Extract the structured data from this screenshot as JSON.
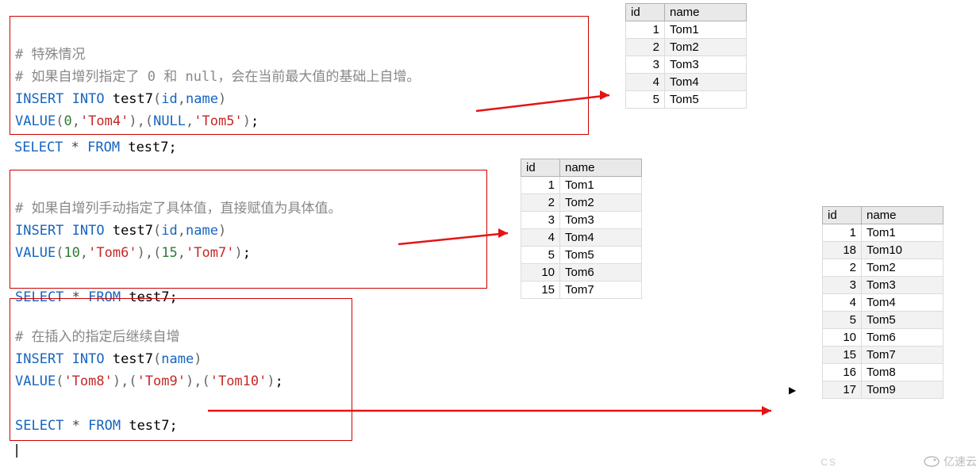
{
  "block1": {
    "c1": "# 特殊情况",
    "c2_a": "# 如果自增列指定了 ",
    "c2_b": "0",
    "c2_c": " 和 ",
    "c2_d": "null",
    "c2_e": "，会在当前最大值的基础上自增。",
    "kw1": "INSERT INTO",
    "call": " test7",
    "args": "id",
    "args2": "name",
    "kw2": "VALUE",
    "v0": "0",
    "s1": "'Tom4'",
    "vnull": "NULL",
    "s2": "'Tom5'",
    "sel_kw1": "SELECT",
    "sel_star": " * ",
    "sel_kw2": "FROM",
    "sel_id": " test7",
    "semi": ";"
  },
  "block2": {
    "c1": "# 如果自增列手动指定了具体值，直接赋值为具体值。",
    "kw1": "INSERT INTO",
    "call": " test7",
    "args": "id",
    "args2": "name",
    "kw2": "VALUE",
    "v10": "10",
    "s1": "'Tom6'",
    "v15": "15",
    "s2": "'Tom7'",
    "sel_kw1": "SELECT",
    "sel_star": " * ",
    "sel_kw2": "FROM",
    "sel_id": " test7",
    "semi": ";"
  },
  "block3": {
    "c1": "# 在插入的指定后继续自增",
    "kw1": "INSERT INTO",
    "call": " test7",
    "args": "name",
    "kw2": "VALUE",
    "s1": "'Tom8'",
    "s2": "'Tom9'",
    "s3": "'Tom10'",
    "sel_kw1": "SELECT",
    "sel_star": " * ",
    "sel_kw2": "FROM",
    "sel_id": " test7",
    "semi": ";"
  },
  "table1": {
    "h1": "id",
    "h2": "name",
    "rows": [
      {
        "id": "1",
        "name": "Tom1"
      },
      {
        "id": "2",
        "name": "Tom2"
      },
      {
        "id": "3",
        "name": "Tom3"
      },
      {
        "id": "4",
        "name": "Tom4"
      },
      {
        "id": "5",
        "name": "Tom5"
      }
    ]
  },
  "table2": {
    "h1": "id",
    "h2": "name",
    "rows": [
      {
        "id": "1",
        "name": "Tom1"
      },
      {
        "id": "2",
        "name": "Tom2"
      },
      {
        "id": "3",
        "name": "Tom3"
      },
      {
        "id": "4",
        "name": "Tom4"
      },
      {
        "id": "5",
        "name": "Tom5"
      },
      {
        "id": "10",
        "name": "Tom6"
      },
      {
        "id": "15",
        "name": "Tom7"
      }
    ]
  },
  "table3": {
    "h1": "id",
    "h2": "name",
    "rows": [
      {
        "id": "1",
        "name": "Tom1"
      },
      {
        "id": "18",
        "name": "Tom10"
      },
      {
        "id": "2",
        "name": "Tom2"
      },
      {
        "id": "3",
        "name": "Tom3"
      },
      {
        "id": "4",
        "name": "Tom4"
      },
      {
        "id": "5",
        "name": "Tom5"
      },
      {
        "id": "10",
        "name": "Tom6"
      },
      {
        "id": "15",
        "name": "Tom7"
      },
      {
        "id": "16",
        "name": "Tom8"
      },
      {
        "id": "17",
        "name": "Tom9"
      }
    ],
    "marker_row": 9,
    "marker": "▶"
  },
  "watermark": "亿速云",
  "watermark_csdn": "CS"
}
